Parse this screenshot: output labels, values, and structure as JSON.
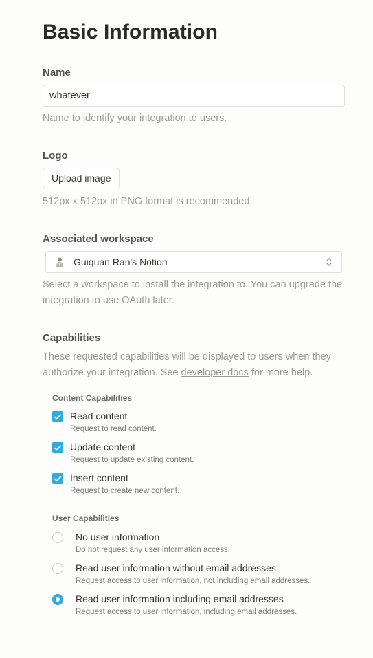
{
  "title": "Basic Information",
  "name_section": {
    "label": "Name",
    "value": "whatever",
    "help": "Name to identify your integration to users."
  },
  "logo_section": {
    "label": "Logo",
    "button": "Upload image",
    "help": "512px x 512px in PNG format is recommended."
  },
  "workspace_section": {
    "label": "Associated workspace",
    "selected": "Guiquan Ran's Notion",
    "icon": "workspace-avatar-icon",
    "help": "Select a workspace to install the integration to. You can upgrade the integration to use OAuth later."
  },
  "capabilities": {
    "label": "Capabilities",
    "help_before": "These requested capabilities will be displayed to users when they authorize your integration. See ",
    "help_link": "developer docs",
    "help_after": " for more help.",
    "content": {
      "heading": "Content Capabilities",
      "items": [
        {
          "label": "Read content",
          "desc": "Request to read content.",
          "checked": true
        },
        {
          "label": "Update content",
          "desc": "Request to update existing content.",
          "checked": true
        },
        {
          "label": "Insert content",
          "desc": "Request to create new content.",
          "checked": true
        }
      ]
    },
    "user": {
      "heading": "User Capabilities",
      "items": [
        {
          "label": "No user information",
          "desc": "Do not request any user information access.",
          "selected": false
        },
        {
          "label": "Read user information without email addresses",
          "desc": "Request access to user information, not including email addresses.",
          "selected": false
        },
        {
          "label": "Read user information including email addresses",
          "desc": "Request access to user information, including email addresses.",
          "selected": true
        }
      ]
    }
  },
  "colors": {
    "accent": "#2eaadc",
    "text": "#37352f",
    "muted": "#9b9a97",
    "border": "#dfdfde"
  }
}
